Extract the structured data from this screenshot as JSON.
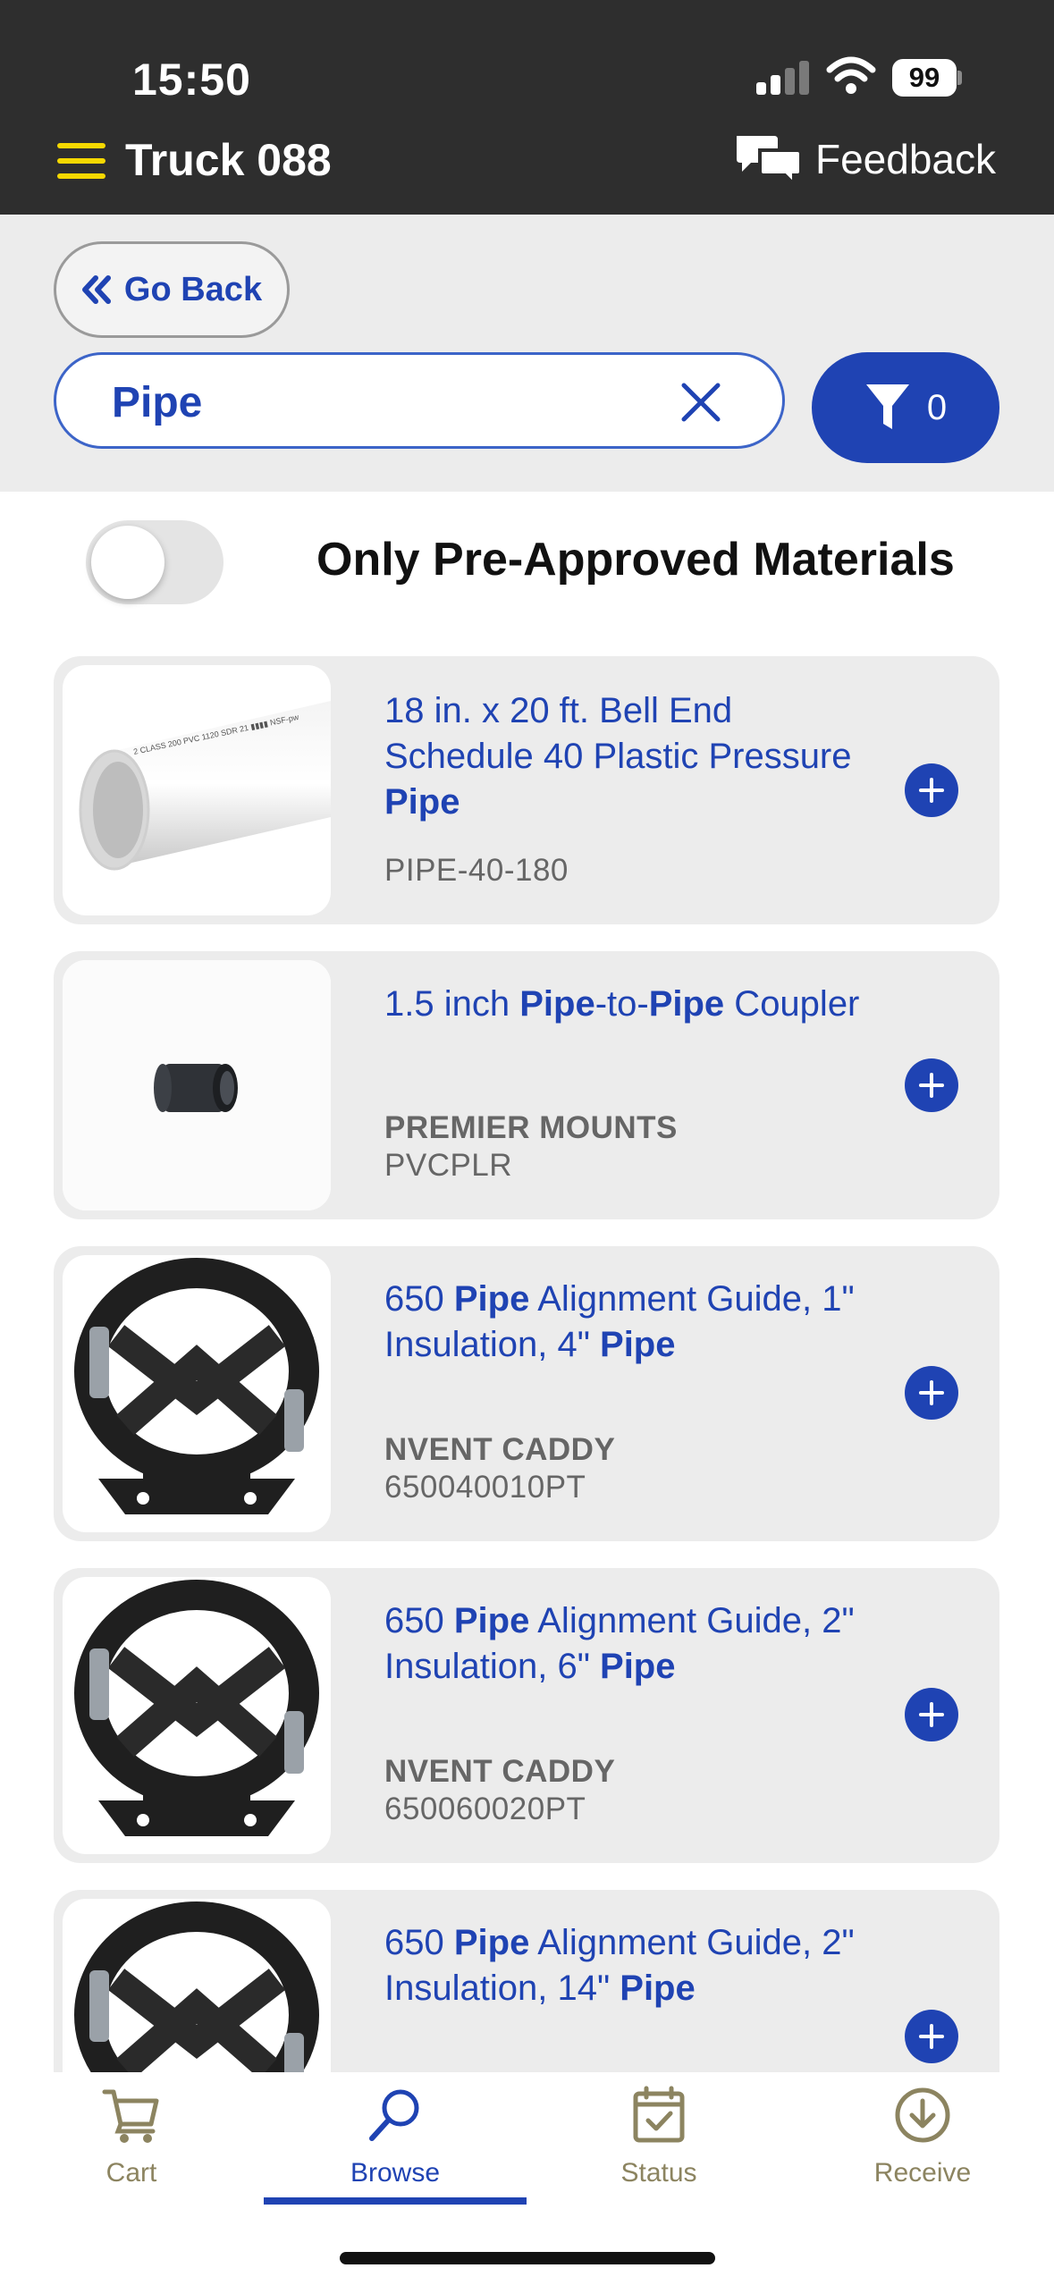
{
  "status_bar": {
    "time": "15:50",
    "battery": "99"
  },
  "header": {
    "title": "Truck 088",
    "feedback_label": "Feedback"
  },
  "search": {
    "go_back_label": "Go Back",
    "query": "Pipe",
    "filter_count": "0"
  },
  "toggle": {
    "label": "Only Pre-Approved Materials",
    "on": false
  },
  "products": [
    {
      "title_parts": [
        "18 in. x 20 ft. Bell End Schedule 40 Plastic Pressure ",
        "Pipe"
      ],
      "brand": "",
      "sku": "PIPE-40-180",
      "image": "white-pvc-pipe"
    },
    {
      "title_parts": [
        "1.5 inch ",
        "Pipe",
        "-to-",
        "Pipe",
        " Coupler"
      ],
      "brand": "PREMIER MOUNTS",
      "sku": "PVCPLR",
      "image": "black-pipe-coupler"
    },
    {
      "title_parts": [
        "650 ",
        "Pipe",
        " Alignment Guide, 1\" Insulation, 4\" ",
        "Pipe"
      ],
      "brand": "NVENT CADDY",
      "sku": "650040010PT",
      "image": "pipe-alignment-guide"
    },
    {
      "title_parts": [
        "650 ",
        "Pipe",
        " Alignment Guide, 2\" Insulation, 6\" ",
        "Pipe"
      ],
      "brand": "NVENT CADDY",
      "sku": "650060020PT",
      "image": "pipe-alignment-guide"
    },
    {
      "title_parts": [
        "650 ",
        "Pipe",
        " Alignment Guide, 2\" Insulation, 14\" ",
        "Pipe"
      ],
      "brand": "",
      "sku": "",
      "image": "pipe-alignment-guide"
    }
  ],
  "bottom_nav": [
    {
      "label": "Cart",
      "icon": "cart-icon"
    },
    {
      "label": "Browse",
      "icon": "search-icon",
      "active": true
    },
    {
      "label": "Status",
      "icon": "calendar-check-icon"
    },
    {
      "label": "Receive",
      "icon": "download-circle-icon"
    }
  ],
  "colors": {
    "brand_blue": "#1f43b3",
    "header_bg": "#2e2e2e",
    "hamburger_yellow": "#f5d800",
    "nav_inactive": "#8c8460",
    "card_bg": "#ececec"
  }
}
